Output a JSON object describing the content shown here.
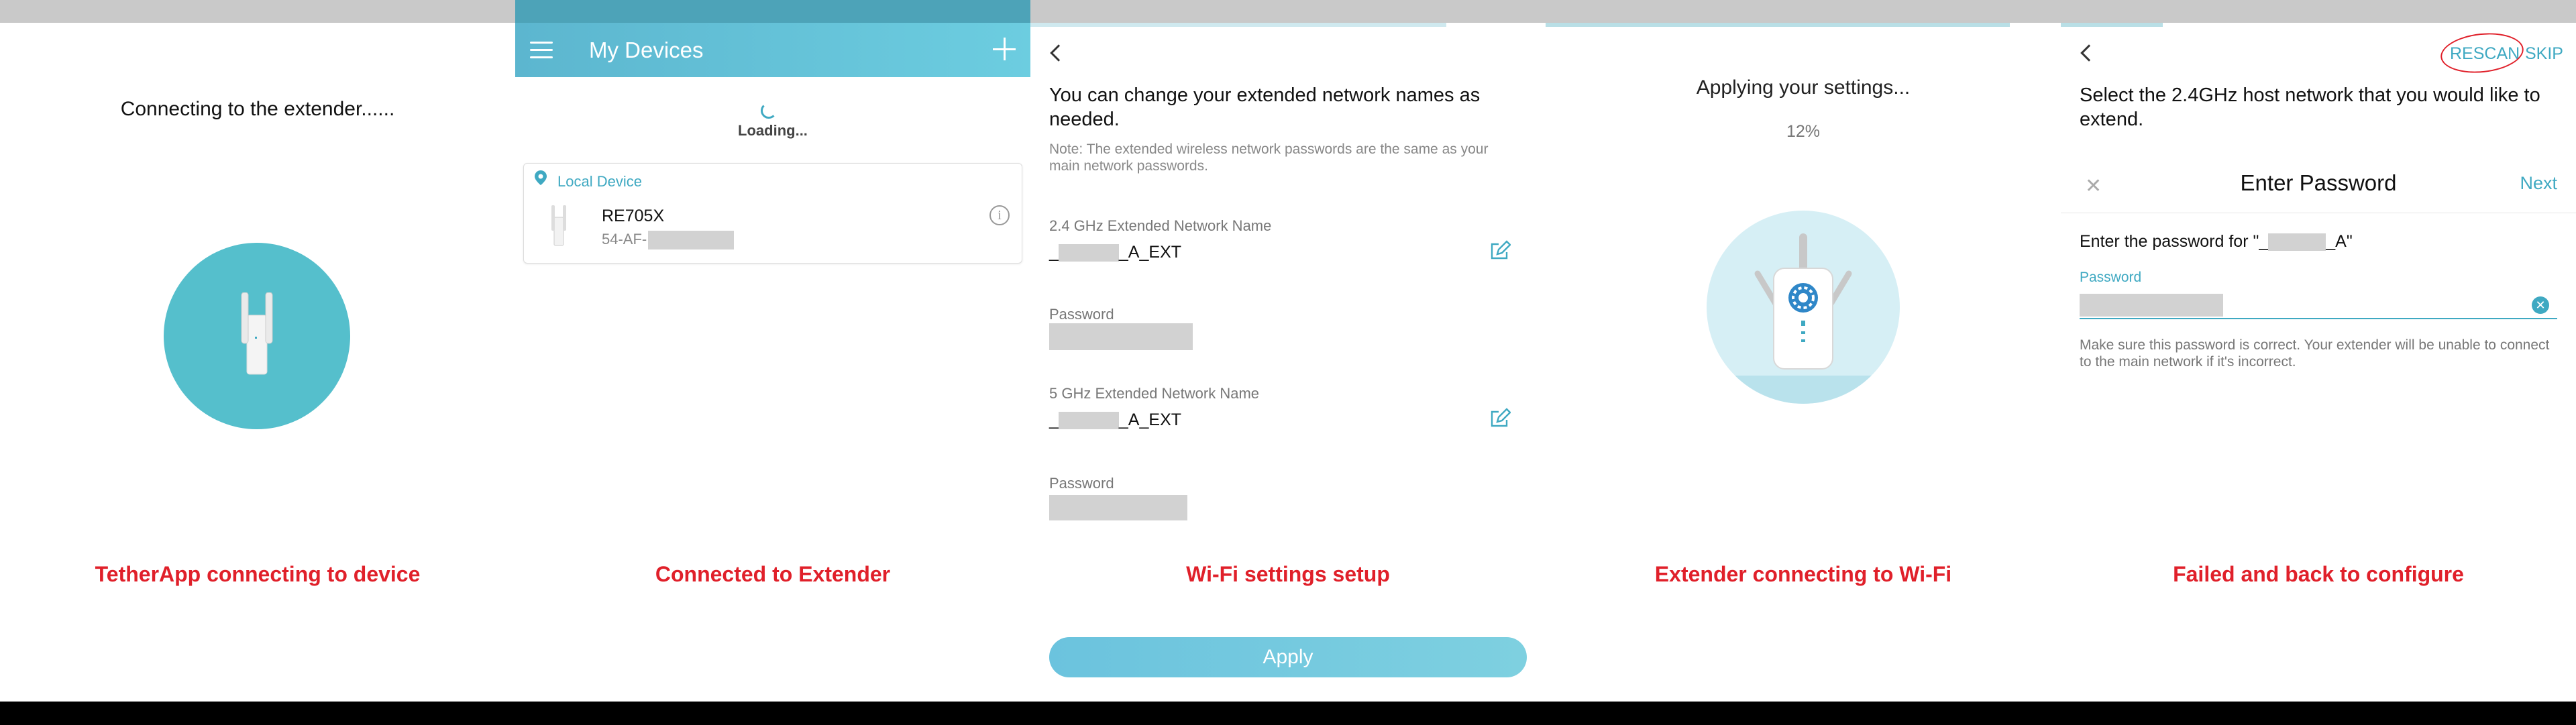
{
  "panel1": {
    "title": "Connecting to the extender......",
    "caption": "TetherApp connecting to device"
  },
  "panel2": {
    "appbar_title": "My Devices",
    "loading": "Loading...",
    "card_section": "Local Device",
    "device_name": "RE705X",
    "device_mac_prefix": "54-AF-",
    "caption": "Connected to Extender"
  },
  "panel3": {
    "heading": "You can change your extended network names as needed.",
    "note": "Note: The extended wireless network passwords are the same as your main network passwords.",
    "field1_label": "2.4 GHz Extended Network Name",
    "field1_prefix": "_",
    "field1_suffix": "_A_EXT",
    "password1_label": "Password",
    "field2_label": "5 GHz Extended Network Name",
    "field2_prefix": "_",
    "field2_suffix": "_A_EXT",
    "password2_label": "Password",
    "apply_button": "Apply",
    "caption": "Wi-Fi settings setup"
  },
  "panel4": {
    "applying": "Applying your settings...",
    "percent": "12%",
    "progress": 0.12,
    "caption": "Extender connecting to Wi-Fi"
  },
  "panel5": {
    "rescan": "RESCAN",
    "skip": "SKIP",
    "heading": "Select the 2.4GHz host network that you would like to extend.",
    "dialog_title": "Enter Password",
    "next": "Next",
    "close": "✕",
    "enter_pw_prefix": "Enter the password for \"_",
    "enter_pw_suffix": "_A\"",
    "password_label": "Password",
    "hint": "Make sure this password is correct. Your extender will be unable to connect to the main network if it's incorrect.",
    "caption": "Failed and back to configure"
  },
  "colors": {
    "accent": "#3fa9c2",
    "caption": "#e0202a",
    "circle": "#55bfcc"
  }
}
